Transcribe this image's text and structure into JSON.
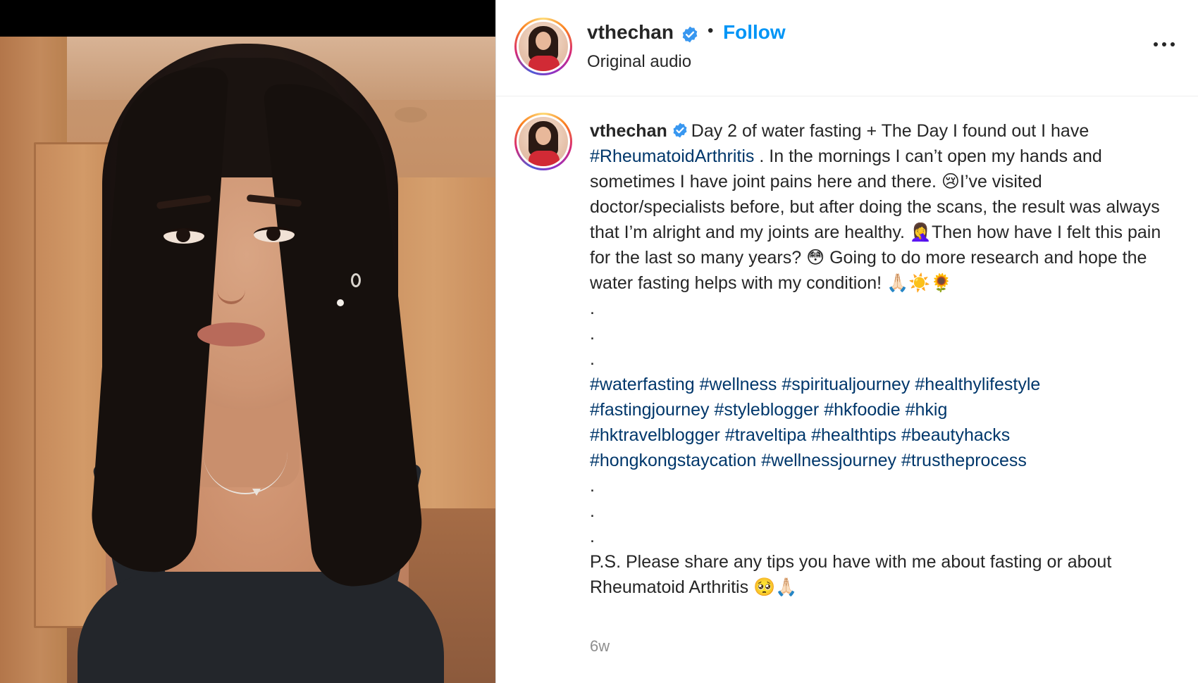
{
  "media": {
    "description_icon": "video-frame"
  },
  "header": {
    "username": "vthechan",
    "separator": "•",
    "follow_label": "Follow",
    "audio_label": "Original audio",
    "more_icon": "more-horizontal-icon"
  },
  "caption": {
    "username": "vthechan",
    "intro": "Day 2 of water fasting + The Day I found out I have",
    "hashtag_ra": "#RheumatoidArthritis",
    "body_1": ". In the mornings I can’t open my hands and sometimes I have joint pains here and there. 😢I’ve visited doctor/specialists before, but after doing the scans, the result was always that I’m alright and my joints are healthy. 🤦‍♀️Then how have I felt this pain for the last so many years? 😳 Going to do more research and hope the water fasting helps with my condition! 🙏🏻☀️🌻",
    "dot": ".",
    "hashtags": [
      "#waterfasting",
      "#wellness",
      "#spiritualjourney",
      "#healthylifestyle",
      "#fastingjourney",
      "#styleblogger",
      "#hkfoodie",
      "#hkig",
      "#hktravelblogger",
      "#traveltipa",
      "#healthtips",
      "#beautyhacks",
      "#hongkongstaycation",
      "#wellnessjourney",
      "#trustheprocess"
    ],
    "ps": "P.S. Please share any tips you have with me about fasting or about Rheumatoid Arthritis 🥺🙏🏻"
  },
  "timestamp": "6w",
  "colors": {
    "follow": "#0095f6",
    "hashtag": "#00376b",
    "verified": "#3897f0",
    "timestamp": "#8e8e8e"
  }
}
